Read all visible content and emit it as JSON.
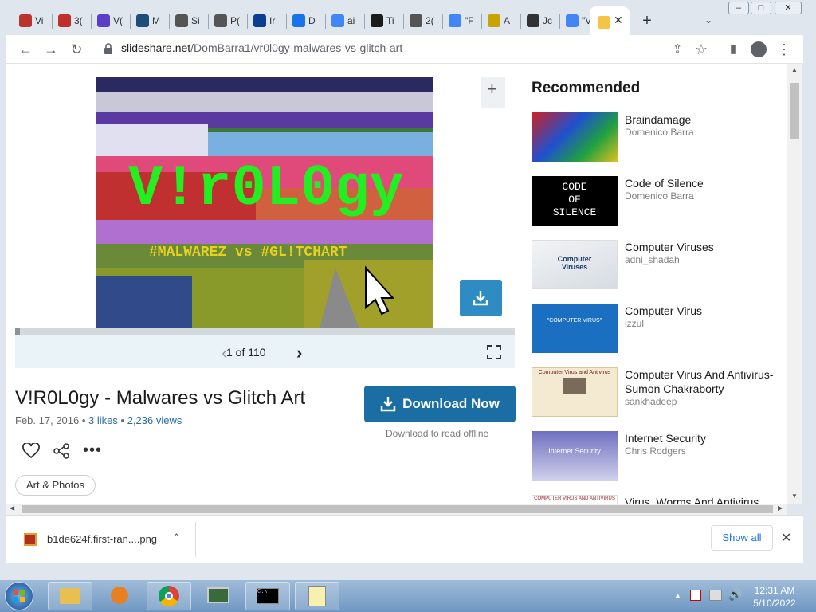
{
  "browser": {
    "tabs": [
      {
        "label": "Vi",
        "icon": "vb-icon",
        "color": "#b8342c"
      },
      {
        "label": "3(",
        "icon": "red-square-icon",
        "color": "#c0302a"
      },
      {
        "label": "V(",
        "icon": "sigma-icon",
        "color": "#5c3fc7"
      },
      {
        "label": "M",
        "icon": "play-icon",
        "color": "#1f4d7a"
      },
      {
        "label": "Si",
        "icon": "globe-icon",
        "color": "#555555"
      },
      {
        "label": "P(",
        "icon": "globe-icon",
        "color": "#555555"
      },
      {
        "label": "Ir",
        "icon": "nasa-icon",
        "color": "#0b3d91"
      },
      {
        "label": "D",
        "icon": "download-icon",
        "color": "#1a73e8"
      },
      {
        "label": "ai",
        "icon": "google-icon",
        "color": "#4285f4"
      },
      {
        "label": "Ti",
        "icon": "tv-icon",
        "color": "#1c1c1c"
      },
      {
        "label": "2(",
        "icon": "globe-icon",
        "color": "#555555"
      },
      {
        "label": "\"F",
        "icon": "google-icon",
        "color": "#4285f4"
      },
      {
        "label": "A",
        "icon": "yellow-logo-icon",
        "color": "#c8a400"
      },
      {
        "label": "Jc",
        "icon": "question-icon",
        "color": "#333333"
      },
      {
        "label": "\"V",
        "icon": "google-icon",
        "color": "#4285f4"
      }
    ],
    "active_tab_close": "✕",
    "new_tab": "+",
    "window_buttons": {
      "minimize": "–",
      "maximize": "□",
      "close": "✕"
    },
    "url_domain": "slideshare.net",
    "url_path": "/DomBarra1/vr0l0gy-malwares-vs-glitch-art"
  },
  "slide": {
    "big_text": "V!r0L0gy",
    "sub_text": "#MALWAREZ vs #GL!TCHART",
    "page_current": "1 of 110",
    "prev": "‹",
    "next": "›"
  },
  "doc": {
    "title": "V!R0L0gy - Malwares vs Glitch Art",
    "date": "Feb. 17, 2016",
    "likes": "3 likes",
    "views": "2,236 views",
    "download_label": "Download Now",
    "download_sub": "Download to read offline",
    "tag": "Art & Photos"
  },
  "recommended": {
    "heading": "Recommended",
    "items": [
      {
        "title": "Braindamage",
        "author": "Domenico Barra"
      },
      {
        "title": "Code of Silence",
        "author": "Domenico Barra",
        "thumb_text": [
          "CODE",
          "OF",
          "SILENCE"
        ]
      },
      {
        "title": "Computer Viruses",
        "author": "adni_shadah",
        "thumb_text": [
          "Computer",
          "Viruses"
        ]
      },
      {
        "title": "Computer Virus",
        "author": "izzul",
        "thumb_text": [
          "\"COMPUTER VIRUS\""
        ]
      },
      {
        "title": "Computer Virus And Antivirus-Sumon Chakraborty",
        "author": "sankhadeep",
        "thumb_text": [
          "Computer Virus and Antivirus"
        ]
      },
      {
        "title": "Internet Security",
        "author": "Chris Rodgers",
        "thumb_text": [
          "Internet Security"
        ]
      },
      {
        "title": "Virus, Worms And Antivirus",
        "author": "",
        "thumb_text": [
          "COMPUTER VIRUS AND ANTIVIRUS"
        ]
      }
    ]
  },
  "download_bar": {
    "file_name": "b1de624f.first-ran....png",
    "show_all": "Show all",
    "close": "✕"
  },
  "taskbar": {
    "time": "12:31 AM",
    "date": "5/10/2022",
    "apps": [
      "explorer",
      "media-player",
      "chrome",
      "task-manager",
      "cmd",
      "notepad"
    ]
  },
  "colors": {
    "accent": "#1b6ea3",
    "download_icon_bg": "#2e8cc2",
    "link": "#1a73e8"
  }
}
